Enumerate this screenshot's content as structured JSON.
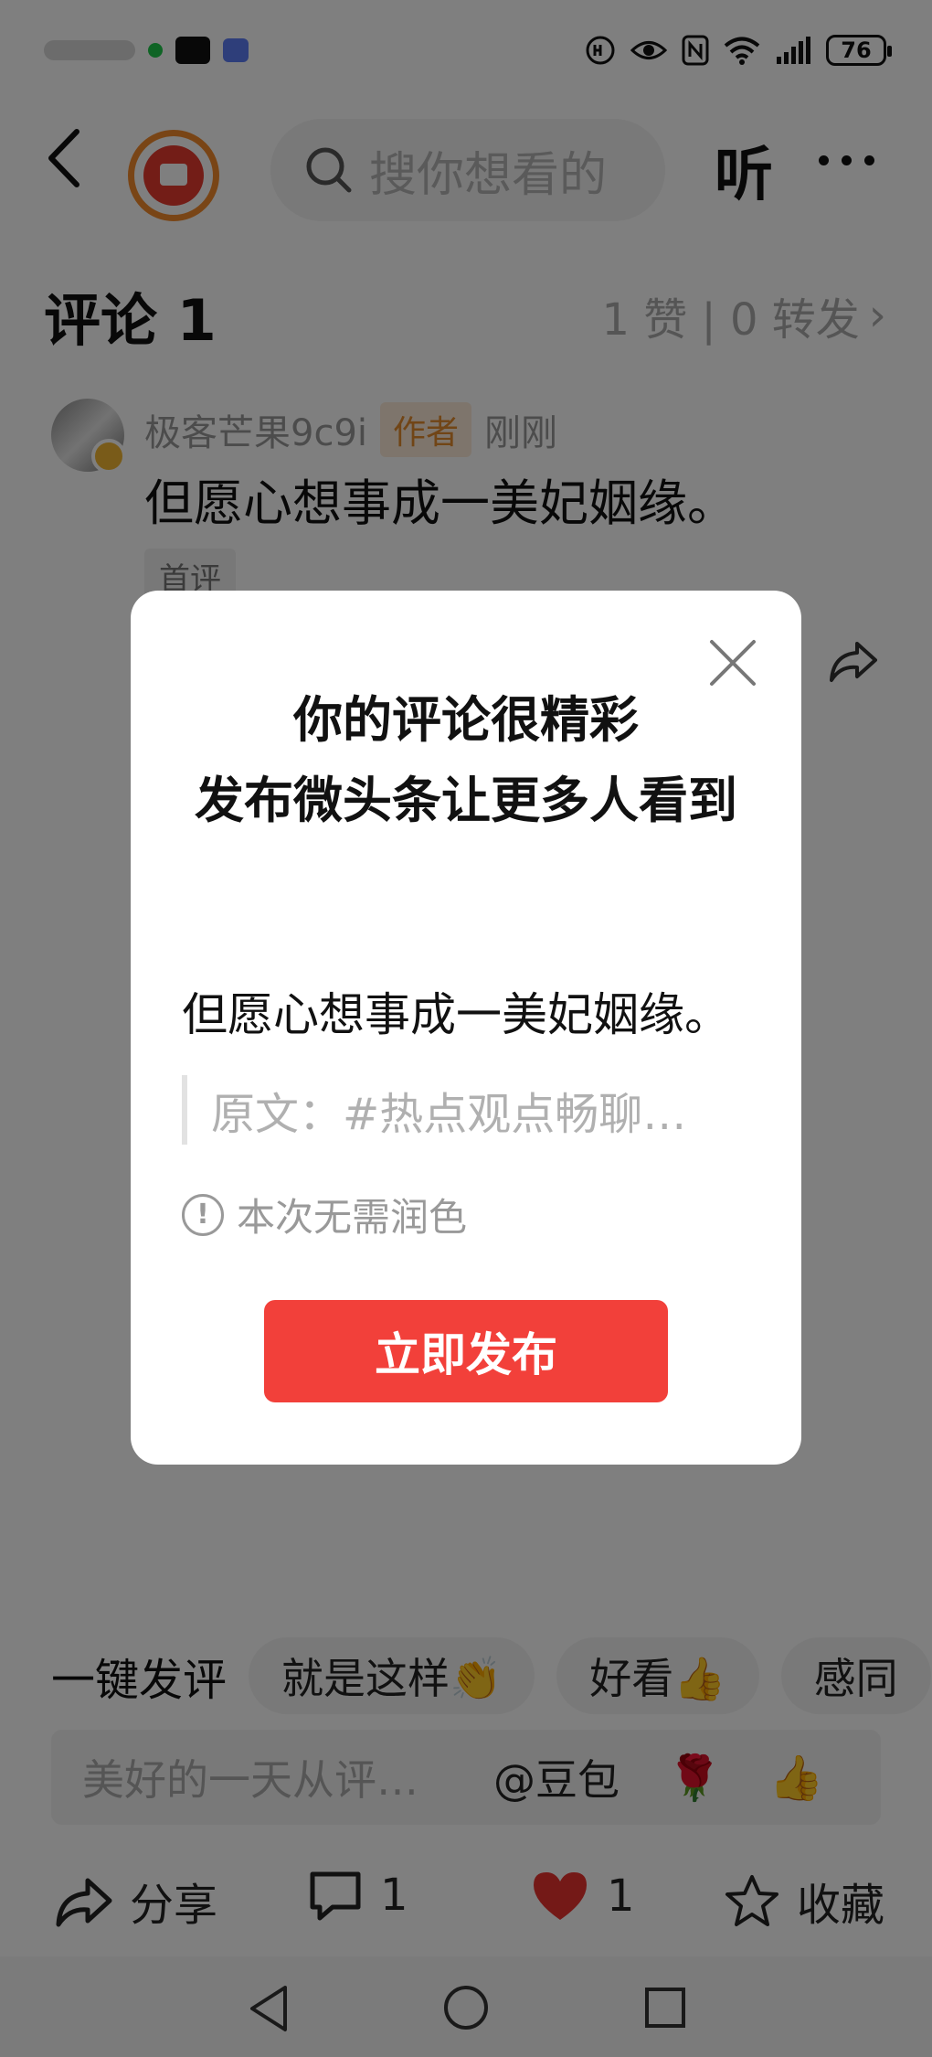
{
  "status_bar": {
    "battery": "76"
  },
  "header": {
    "search_placeholder": "搜你想看的",
    "listen_label": "听"
  },
  "comments": {
    "title": "评论 1",
    "stats": "1 赞 | 0 转发",
    "stats_chevron": "›",
    "item": {
      "username": "极客芒果9c9i",
      "author_badge": "作者",
      "time": "刚刚",
      "text": "但愿心想事成一美妃姻缘。",
      "tag": "首评"
    }
  },
  "quick_reply": {
    "label": "一键发评",
    "chips": [
      "就是这样👏",
      "好看👍",
      "感同"
    ]
  },
  "input": {
    "placeholder": "美好的一天从评…",
    "mention": "@豆包",
    "emoji_1": "🌹",
    "emoji_2": "👍"
  },
  "bottom_bar": {
    "share_label": "分享",
    "comment_count": "1",
    "like_count": "1",
    "favorite_label": "收藏"
  },
  "modal": {
    "title_line1": "你的评论很精彩",
    "title_line2": "发布微头条让更多人看到",
    "comment_text": "但愿心想事成一美妃姻缘。",
    "quote_text": "原文：#热点观点畅聊…",
    "note": "本次无需润色",
    "publish_label": "立即发布"
  },
  "colors": {
    "accent_red": "#f2403a",
    "author_badge_bg": "#fdebd8",
    "author_badge_text": "#e38a2d"
  }
}
